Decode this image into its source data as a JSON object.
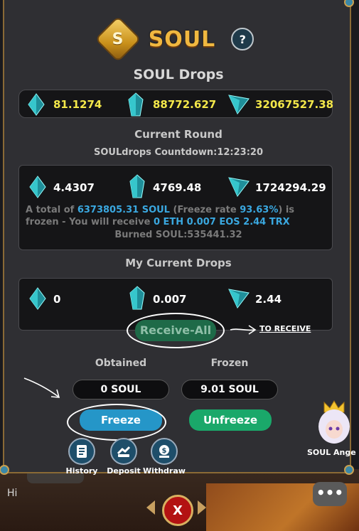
{
  "background": {
    "chat_greeting": "Hi",
    "chat_icon": "chat-bubble-icon"
  },
  "header": {
    "title": "SOUL",
    "coin_letter": "S",
    "help_label": "?"
  },
  "drops": {
    "heading": "SOUL Drops",
    "eth": "81.1274",
    "eos": "88772.627",
    "trx": "32067527.38"
  },
  "current_round": {
    "heading": "Current Round",
    "countdown": "SOULdrops Countdown:12:23:20",
    "eth": "4.4307",
    "eos": "4769.48",
    "trx": "1724294.29",
    "frozen_text_1": "A total of",
    "frozen_amount": "6373805.31 SOUL",
    "frozen_text_2": "(Freeze rate",
    "freeze_rate": "93.63%",
    "frozen_text_3": ") is",
    "frozen_text_4": "frozen - You will receive",
    "receive_amounts": "0 ETH 0.007 EOS 2.44 TRX",
    "burned": "Burned SOUL:535441.32"
  },
  "my_drops": {
    "heading": "My Current Drops",
    "eth": "0",
    "eos": "0.007",
    "trx": "2.44",
    "receive_all_label": "Receive-All",
    "annotation": "TO RECEIVE"
  },
  "stake": {
    "obtained_label": "Obtained",
    "frozen_label": "Frozen",
    "obtained_value": "0 SOUL",
    "frozen_value": "9.01 SOUL",
    "freeze_label": "Freeze",
    "unfreeze_label": "Unfreeze"
  },
  "nav": [
    {
      "label": "History",
      "icon": "history-icon"
    },
    {
      "label": "Deposit",
      "icon": "deposit-icon"
    },
    {
      "label": "Withdraw",
      "icon": "withdraw-icon"
    }
  ],
  "side": {
    "angel_label": "SOUL Ange"
  },
  "close_label": "X",
  "colors": {
    "gold": "#f0b840",
    "blue_button": "#2596c8",
    "green_button": "#1aa86a",
    "close_red": "#b31212"
  }
}
